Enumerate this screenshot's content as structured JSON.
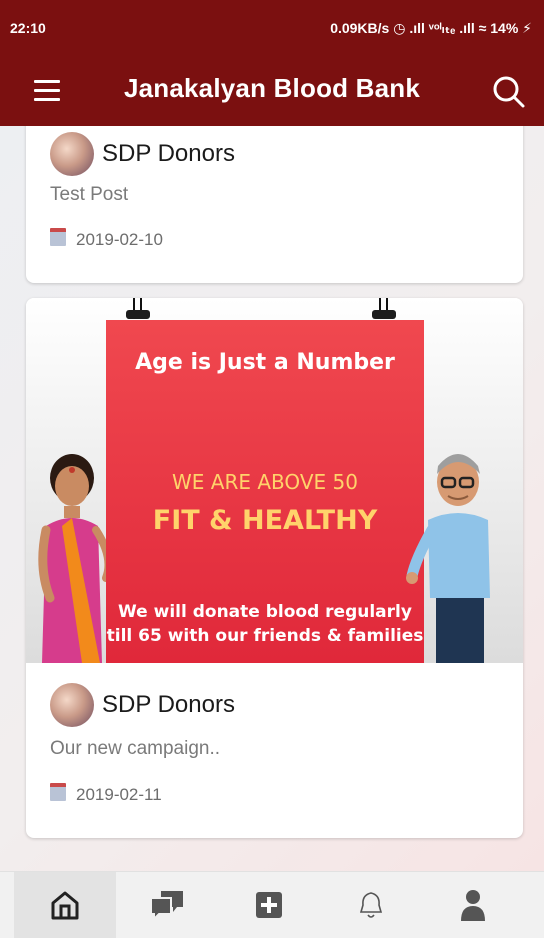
{
  "status_bar": {
    "time": "22:10",
    "right": "0.09KB/s ◷ .ıll ᵛᵒˡₗₜₑ .ıll ≈ 14% ⚡"
  },
  "app_bar": {
    "title": "Janakalyan Blood Bank",
    "menu_icon": "hamburger-icon",
    "search_icon": "search-icon",
    "color": "#7b1010"
  },
  "posts": [
    {
      "author": "SDP Donors",
      "text": "Test Post",
      "date": "2019-02-10"
    },
    {
      "author": "SDP Donors",
      "text": "Our new campaign..",
      "date": "2019-02-11",
      "image": {
        "heading": "Age is Just a Number",
        "line1": "WE ARE ABOVE 50",
        "line2": "FIT & HEALTHY",
        "line3": "We will donate blood regularly till 65 with our friends & families"
      }
    }
  ],
  "bottom_nav": [
    {
      "icon": "home-icon",
      "active": true
    },
    {
      "icon": "chat-icon",
      "active": false
    },
    {
      "icon": "add-icon",
      "active": false
    },
    {
      "icon": "bell-icon",
      "active": false
    },
    {
      "icon": "profile-icon",
      "active": false
    }
  ]
}
